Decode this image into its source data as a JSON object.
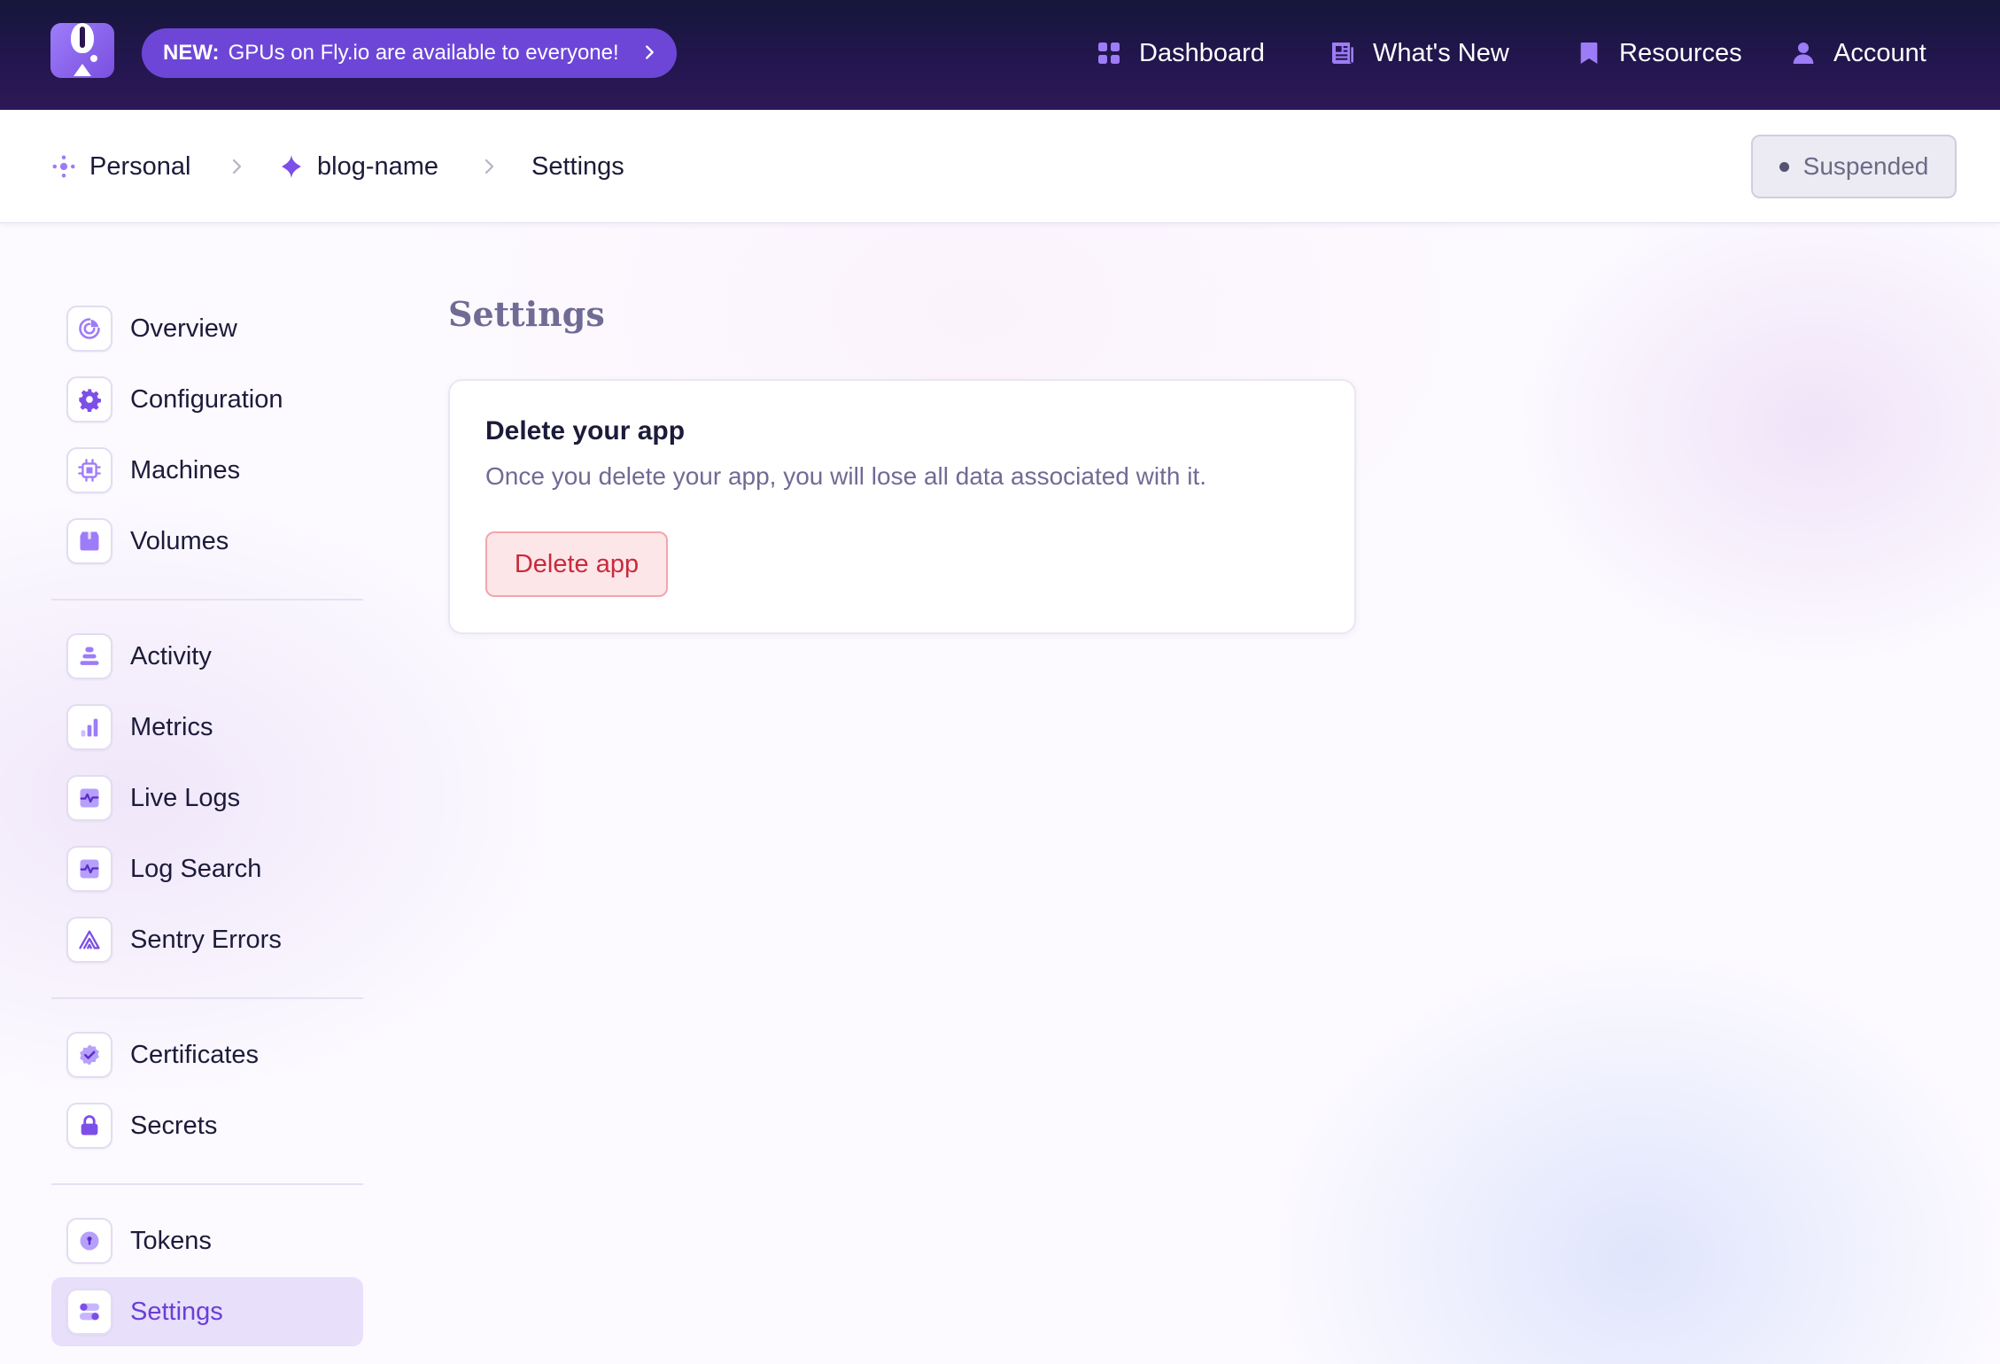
{
  "topbar": {
    "announcement": {
      "prefix": "NEW:",
      "text": "GPUs on Fly.io are available to everyone!"
    },
    "nav": [
      {
        "label": "Dashboard",
        "icon": "grid-icon"
      },
      {
        "label": "What's New",
        "icon": "newspaper-icon"
      },
      {
        "label": "Resources",
        "icon": "bookmark-icon"
      },
      {
        "label": "Account",
        "icon": "user-icon"
      }
    ]
  },
  "breadcrumb": {
    "items": [
      {
        "label": "Personal",
        "icon": "org-dots-icon"
      },
      {
        "label": "blog-name",
        "icon": "sparkle-icon"
      },
      {
        "label": "Settings"
      }
    ],
    "status": "Suspended"
  },
  "sidebar": {
    "groups": [
      [
        {
          "label": "Overview",
          "icon": "overview-icon"
        },
        {
          "label": "Configuration",
          "icon": "gear-icon"
        },
        {
          "label": "Machines",
          "icon": "chip-icon"
        },
        {
          "label": "Volumes",
          "icon": "box-icon"
        }
      ],
      [
        {
          "label": "Activity",
          "icon": "activity-icon"
        },
        {
          "label": "Metrics",
          "icon": "bar-chart-icon"
        },
        {
          "label": "Live Logs",
          "icon": "pulse-icon"
        },
        {
          "label": "Log Search",
          "icon": "pulse-icon"
        },
        {
          "label": "Sentry Errors",
          "icon": "sentry-icon"
        }
      ],
      [
        {
          "label": "Certificates",
          "icon": "badge-check-icon"
        },
        {
          "label": "Secrets",
          "icon": "lock-icon"
        }
      ],
      [
        {
          "label": "Tokens",
          "icon": "token-icon"
        },
        {
          "label": "Settings",
          "icon": "toggles-icon",
          "active": true
        }
      ]
    ]
  },
  "main": {
    "title": "Settings",
    "card": {
      "title": "Delete your app",
      "description": "Once you delete your app, you will lose all data associated with it.",
      "button": "Delete app"
    }
  },
  "colors": {
    "accent": "#7c4fe8",
    "topbar": "#1a1740",
    "danger": "#c92a3e",
    "danger_bg": "#fde6e8"
  }
}
